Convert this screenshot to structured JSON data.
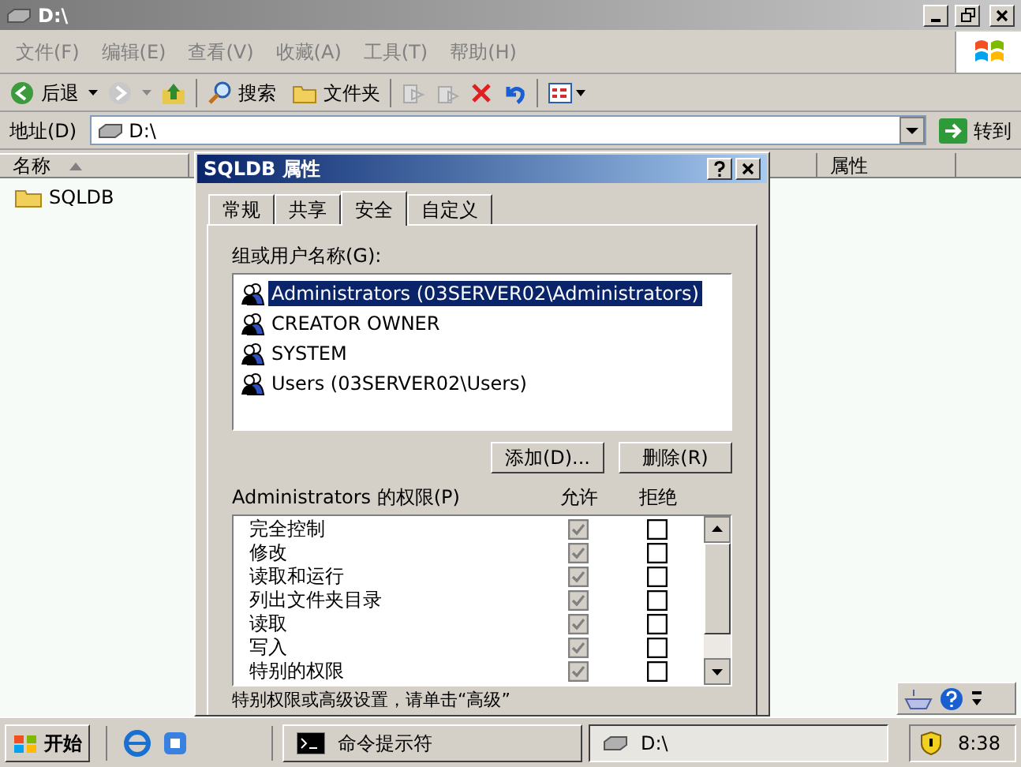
{
  "explorer": {
    "title": "D:\\",
    "menu": [
      "文件(F)",
      "编辑(E)",
      "查看(V)",
      "收藏(A)",
      "工具(T)",
      "帮助(H)"
    ],
    "toolbar": {
      "back": "后退",
      "search": "搜索",
      "folders": "文件夹"
    },
    "address": {
      "label": "地址(D)",
      "value": "D:\\",
      "go": "转到"
    },
    "columns": [
      {
        "label": "名称",
        "sorted": true
      },
      {
        "label": "属性",
        "sorted": false
      }
    ],
    "items": [
      {
        "name": "SQLDB",
        "selected": false
      }
    ]
  },
  "dialog": {
    "title": "SQLDB 属性",
    "tabs": [
      {
        "label": "常规",
        "selected": false
      },
      {
        "label": "共享",
        "selected": false
      },
      {
        "label": "安全",
        "selected": true
      },
      {
        "label": "自定义",
        "selected": false
      }
    ],
    "users_label": "组或用户名称(G):",
    "users": [
      {
        "name": "Administrators (03SERVER02\\Administrators)",
        "selected": true
      },
      {
        "name": "CREATOR OWNER",
        "selected": false
      },
      {
        "name": "SYSTEM",
        "selected": false
      },
      {
        "name": "Users (03SERVER02\\Users)",
        "selected": false
      }
    ],
    "buttons": [
      "添加(D)...",
      "删除(R)"
    ],
    "permissions_label": "Administrators 的权限(P)",
    "allow_header": "允许",
    "deny_header": "拒绝",
    "permissions": [
      {
        "name": "完全控制",
        "allow": true,
        "deny": false,
        "inherited": true
      },
      {
        "name": "修改",
        "allow": true,
        "deny": false,
        "inherited": true
      },
      {
        "name": "读取和运行",
        "allow": true,
        "deny": false,
        "inherited": true
      },
      {
        "name": "列出文件夹目录",
        "allow": true,
        "deny": false,
        "inherited": true
      },
      {
        "name": "读取",
        "allow": true,
        "deny": false,
        "inherited": true
      },
      {
        "name": "写入",
        "allow": true,
        "deny": false,
        "inherited": true
      },
      {
        "name": "特别的权限",
        "allow": true,
        "deny": false,
        "inherited": true
      }
    ],
    "note": "特别权限或高级设置，请单击“高级”"
  },
  "taskbar": {
    "start": "开始",
    "tasks": [
      {
        "label": "命令提示符",
        "kind": "console",
        "selected": false
      },
      {
        "label": "D:\\",
        "kind": "drive",
        "selected": true
      }
    ],
    "clock": "8:38"
  }
}
